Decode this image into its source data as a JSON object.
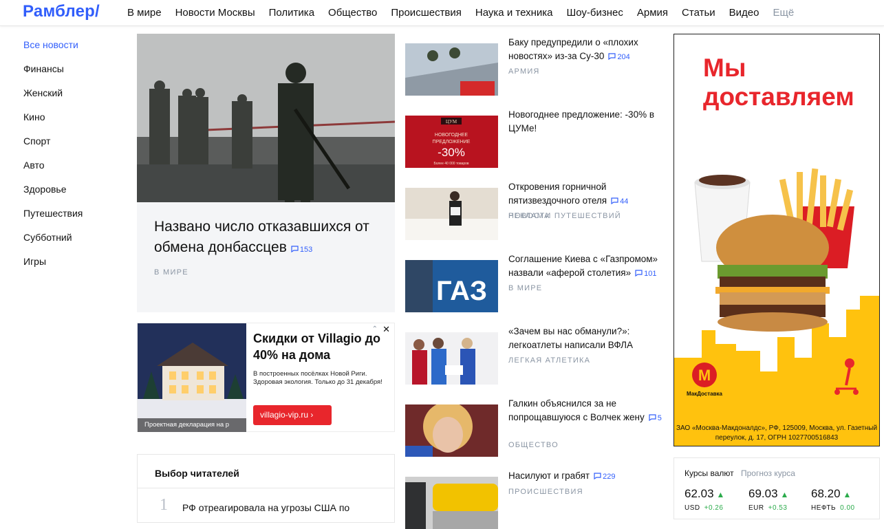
{
  "header": {
    "logo": "Рамблер/",
    "nav": [
      "В мире",
      "Новости Москвы",
      "Политика",
      "Общество",
      "Происшествия",
      "Наука и техника",
      "Шоу-бизнес",
      "Армия",
      "Статьи",
      "Видео"
    ],
    "more": "Ещё"
  },
  "sidebar": {
    "items": [
      "Все новости",
      "Финансы",
      "Женский",
      "Кино",
      "Спорт",
      "Авто",
      "Здоровье",
      "Путешествия",
      "Субботний",
      "Игры"
    ]
  },
  "featured": {
    "title": "Названо число отказавшихся от обмена донбассцев",
    "comments": "153",
    "category": "В МИРЕ"
  },
  "ad_left": {
    "title": "Скидки от Villagio до 40% на дома",
    "text": "В построенных посёлках Новой Риги. Здоровая экология. Только до 31 декабря!",
    "button": "villagio-vip.ru",
    "caption": "Проектная декларация на p",
    "close": "✕",
    "flag": "⌃"
  },
  "readers": {
    "title": "Выбор читателей",
    "items": [
      {
        "num": "1",
        "text": "РФ отреагировала на угрозы США по"
      }
    ]
  },
  "news": [
    {
      "title": "Баку предупредили о «плохих новостях» из-за Су-30",
      "comments": "204",
      "category": "АРМИЯ"
    },
    {
      "title": "Новогоднее предложение: -30% в ЦУМе!",
      "comments": "",
      "category": "РЕКЛАМА"
    },
    {
      "title": "Откровения горничной пятизвездочного отеля",
      "comments": "44",
      "category": "НОВОСТИ ПУТЕШЕСТВИЙ"
    },
    {
      "title": "Соглашение Киева с «Газпромом» назвали «аферой столетия»",
      "comments": "101",
      "category": "В МИРЕ"
    },
    {
      "title": "«Зачем вы нас обманули?»: легкоатлеты написали ВФЛА",
      "comments": "",
      "category": "ЛЕГКАЯ АТЛЕТИКА"
    },
    {
      "title": "Галкин объяснился за не попрощавшуюся с Волчек жену",
      "comments": "5",
      "category": "ОБЩЕСТВО"
    },
    {
      "title": "Насилуют и грабят",
      "comments": "229",
      "category": "ПРОИСШЕСТВИЯ"
    }
  ],
  "tsum_ad": {
    "logo": "ЦУМ",
    "line1": "НОВОГОДНЕЕ",
    "line2": "ПРЕДЛОЖЕНИЕ",
    "discount": "-30%",
    "footer": "Более 40 000 товаров"
  },
  "gazprom_thumb": {
    "text": "ГАЗ"
  },
  "ad_right": {
    "headline1": "Мы",
    "headline2": "доставляем",
    "brand": "МакДоставка",
    "legal": "ЗАО «Москва-Макдоналдс», РФ, 125009, Москва, ул. Газетный переулок, д. 17, ОГРН 1027700516843"
  },
  "rates": {
    "tab_active": "Курсы валют",
    "tab_other": "Прогноз курса",
    "items": [
      {
        "value": "62.03",
        "code": "USD",
        "delta": "+0.26"
      },
      {
        "value": "69.03",
        "code": "EUR",
        "delta": "+0.53"
      },
      {
        "value": "68.20",
        "code": "НЕФТЬ",
        "delta": "0.00"
      }
    ]
  },
  "colors": {
    "accent": "#315efb",
    "ad_red": "#e8262c",
    "positive": "#2bab4b",
    "muted": "#8a95a3"
  }
}
